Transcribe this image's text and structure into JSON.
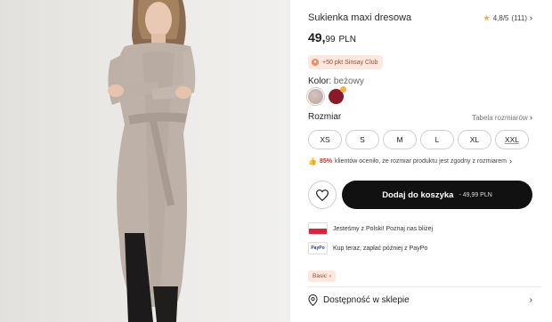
{
  "product": {
    "title": "Sukienka maxi dresowa",
    "rating": "4,8/5",
    "rating_count": "(111)",
    "price_main": "49,",
    "price_cents": "99",
    "price_currency": "PLN"
  },
  "club_badge": "+50 pkt Sinsay Club",
  "color": {
    "label": "Kolor:",
    "value": "beżowy",
    "swatches": [
      "#c9b3ad",
      "#8a1a2a"
    ]
  },
  "size": {
    "label": "Rozmiar",
    "table_link": "Tabela rozmiarów",
    "options": [
      "XS",
      "S",
      "M",
      "L",
      "XL",
      "XXL"
    ]
  },
  "fit_note": {
    "percent": "85%",
    "text": "klientów oceniło, że rozmiar produktu jest zgodny z rozmiarem"
  },
  "add_to_cart": {
    "label": "Dodaj do koszyka",
    "price": "- 49,99 PLN"
  },
  "info": {
    "poland": "Jesteśmy z Polski! Poznaj nas bliżej",
    "paypo": "Kup teraz, zapłać później z PayPo",
    "paypo_logo": "PayPo"
  },
  "tag": "Basic",
  "store": "Dostępność w sklepie",
  "colors": {
    "accent": "#f08b5b",
    "cart_bg": "#111111",
    "badge_bg": "#fde7df"
  }
}
